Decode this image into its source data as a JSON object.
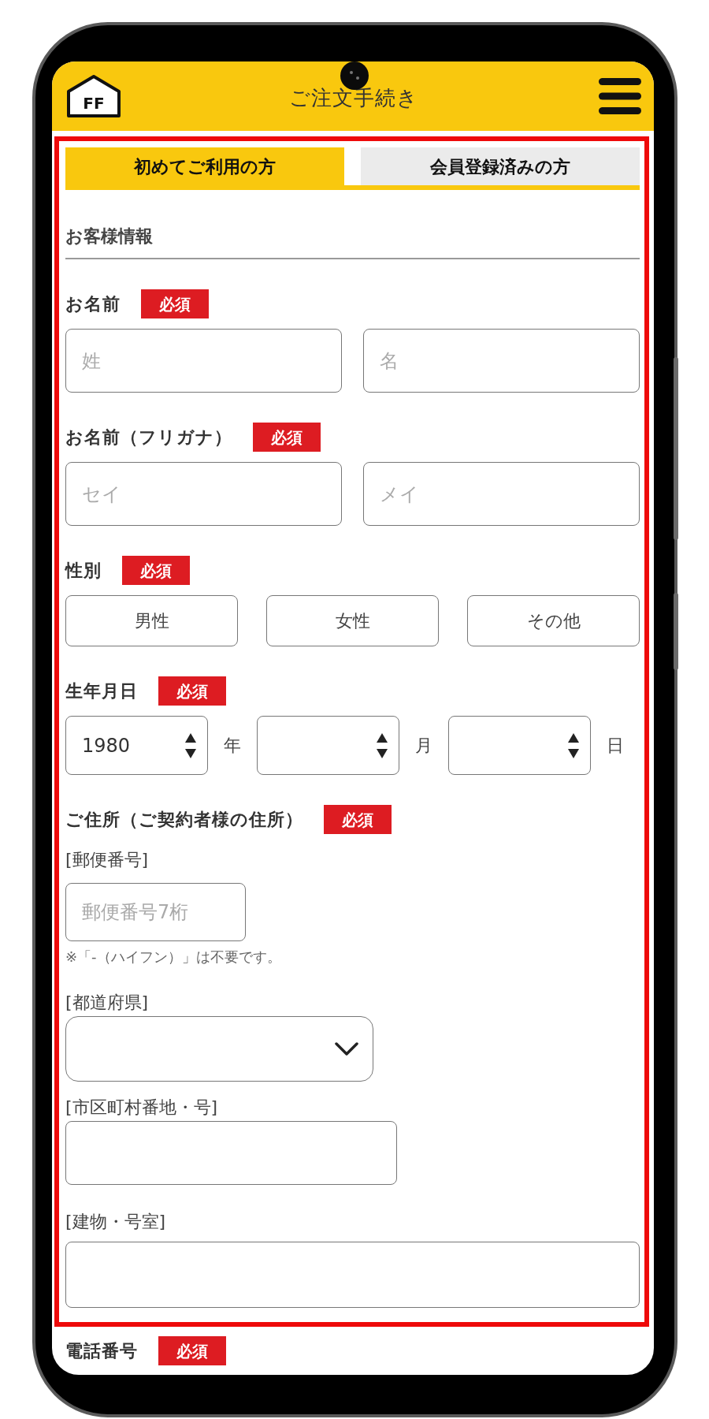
{
  "header": {
    "logo": "FF",
    "title": "ご注文手続き"
  },
  "tabs": [
    {
      "label": "初めてご利用の方",
      "selected": true
    },
    {
      "label": "会員登録済みの方",
      "selected": false
    }
  ],
  "section": {
    "title": "お客様情報"
  },
  "fields": [
    {
      "kind": "pair",
      "label": "お名前",
      "badge": "必須",
      "inputs": [
        {
          "placeholder": "姓"
        },
        {
          "placeholder": "名"
        }
      ]
    },
    {
      "kind": "pair",
      "label": "お名前（フリガナ）",
      "badge": "必須",
      "inputs": [
        {
          "placeholder": "セイ"
        },
        {
          "placeholder": "メイ"
        }
      ]
    },
    {
      "kind": "choice",
      "label": "性別",
      "badge": "必須",
      "options": [
        {
          "label": "男性",
          "selected": false
        },
        {
          "label": "女性",
          "selected": false
        },
        {
          "label": "その他",
          "selected": false
        }
      ]
    },
    {
      "kind": "date",
      "label": "生年月日",
      "badge": "必須",
      "selects": [
        {
          "value": "1980",
          "unit": "年"
        },
        {
          "unit": "月"
        },
        {
          "unit": "日"
        }
      ]
    },
    {
      "kind": "address",
      "label": "ご住所（ご契約者様の住所）",
      "badge": "必須",
      "parts": [
        {
          "kind": "input",
          "label": "[郵便番号]",
          "placeholder": "郵便番号7桁",
          "note": "※「-（ハイフン）」は不要です。"
        },
        {
          "kind": "select",
          "label": "[都道府県]"
        },
        {
          "kind": "input",
          "label": "[市区町村番地・号]"
        },
        {
          "kind": "input",
          "label": "[建物・号室]"
        }
      ]
    }
  ],
  "next_field": {
    "label": "電話番号",
    "badge": "必須"
  }
}
